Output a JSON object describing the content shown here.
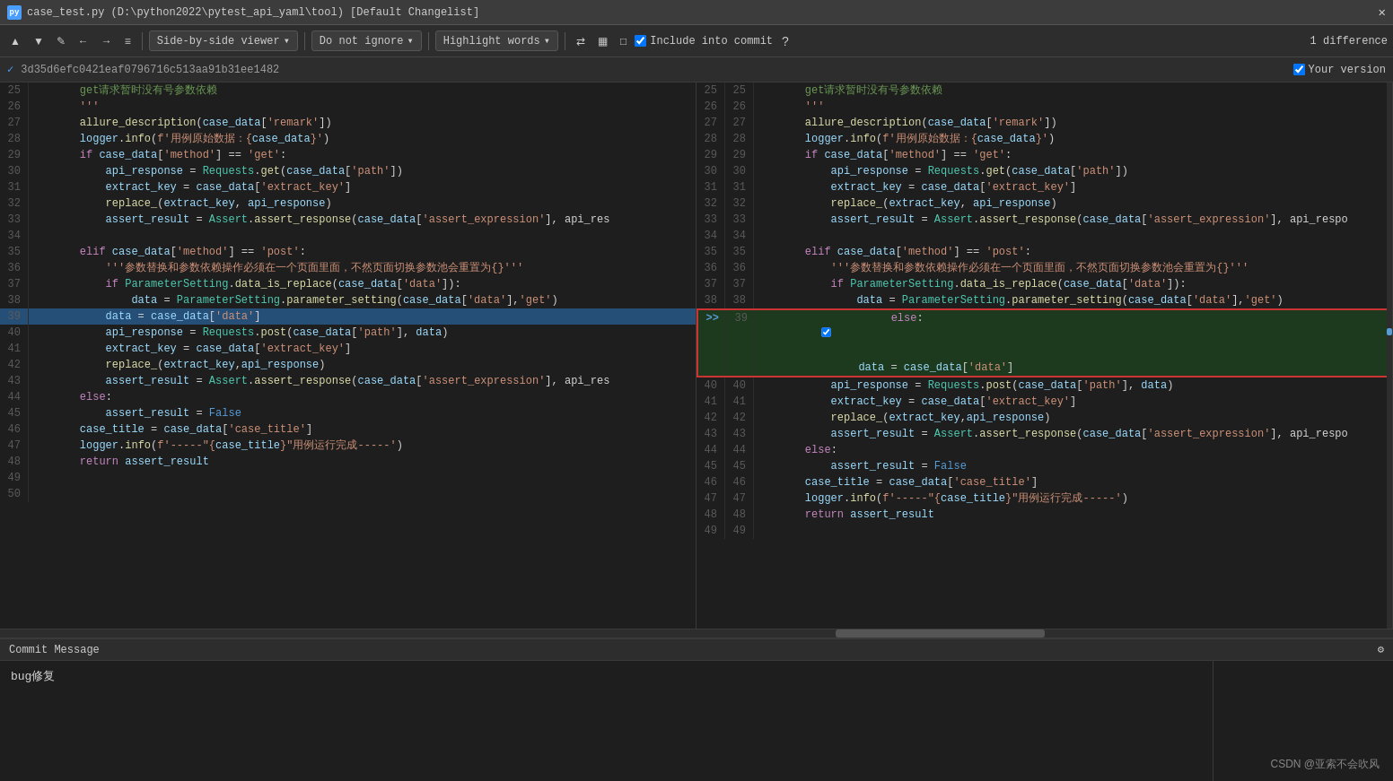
{
  "titleBar": {
    "icon": "py",
    "title": "case_test.py (D:\\python2022\\pytest_api_yaml\\tool) [Default Changelist]",
    "closeLabel": "✕"
  },
  "toolbar": {
    "prevBtn": "↑",
    "nextBtn": "↓",
    "editBtn": "✎",
    "backBtn": "←",
    "forwardBtn": "→",
    "menuBtn": "≡",
    "viewerLabel": "Side-by-side viewer",
    "viewerDropdown": "▾",
    "ignoreLabel": "Do not ignore",
    "ignoreDropdown": "▾",
    "highlightLabel": "Highlight words",
    "highlightDropdown": "▾",
    "icon1": "⇄",
    "icon2": "▦",
    "icon3": "□",
    "checkboxLabel": "Include into commit",
    "questionBtn": "?",
    "diffCount": "1 difference"
  },
  "hashBar": {
    "checkIcon": "✓",
    "hash": "3d35d6efc0421eaf0796716c513aa91b31ee1482",
    "yourVersionLabel": "Your version",
    "yourVersionChecked": true
  },
  "leftPanel": {
    "lines": [
      {
        "num": "25",
        "gutter": "",
        "content": "    get请求暂时没有号参数依赖",
        "type": "comment-cn"
      },
      {
        "num": "26",
        "gutter": "",
        "content": "    '''",
        "type": "str"
      },
      {
        "num": "27",
        "gutter": "",
        "content": "    allure_description(case_data['remark'])",
        "type": "normal"
      },
      {
        "num": "28",
        "gutter": "",
        "content": "    logger.info(f'用例原始数据：{case_data}')",
        "type": "normal"
      },
      {
        "num": "29",
        "gutter": "",
        "content": "    if case_data['method'] == 'get':",
        "type": "normal"
      },
      {
        "num": "30",
        "gutter": "",
        "content": "        api_response = Requests.get(case_data['path'])",
        "type": "normal"
      },
      {
        "num": "31",
        "gutter": "",
        "content": "        extract_key = case_data['extract_key']",
        "type": "normal"
      },
      {
        "num": "32",
        "gutter": "",
        "content": "        replace_(extract_key, api_response)",
        "type": "normal"
      },
      {
        "num": "33",
        "gutter": "",
        "content": "        assert_result = Assert.assert_response(case_data['assert_expression'], api_res",
        "type": "normal"
      },
      {
        "num": "34",
        "gutter": "",
        "content": "",
        "type": "empty"
      },
      {
        "num": "35",
        "gutter": "",
        "content": "    elif case_data['method'] == 'post':",
        "type": "normal"
      },
      {
        "num": "36",
        "gutter": "",
        "content": "        '''参数替换和参数依赖操作必须在一个页面里面，不然页面切换参数池会重置为{}'''",
        "type": "str-cn"
      },
      {
        "num": "37",
        "gutter": "",
        "content": "        if ParameterSetting.data_is_replace(case_data['data']):",
        "type": "normal"
      },
      {
        "num": "38",
        "gutter": "",
        "content": "            data = ParameterSetting.parameter_setting(case_data['data'],'get')",
        "type": "normal"
      },
      {
        "num": "39",
        "gutter": "  ",
        "content": "        data = case_data['data']",
        "type": "changed"
      },
      {
        "num": "40",
        "gutter": "",
        "content": "        api_response = Requests.post(case_data['path'], data)",
        "type": "normal"
      },
      {
        "num": "41",
        "gutter": "",
        "content": "        extract_key = case_data['extract_key']",
        "type": "normal"
      },
      {
        "num": "42",
        "gutter": "",
        "content": "        replace_(extract_key,api_response)",
        "type": "normal"
      },
      {
        "num": "43",
        "gutter": "",
        "content": "        assert_result = Assert.assert_response(case_data['assert_expression'], api_res",
        "type": "normal"
      },
      {
        "num": "44",
        "gutter": "",
        "content": "    else:",
        "type": "normal"
      },
      {
        "num": "45",
        "gutter": "",
        "content": "        assert_result = False",
        "type": "normal"
      },
      {
        "num": "46",
        "gutter": "",
        "content": "    case_title = case_data['case_title']",
        "type": "normal"
      },
      {
        "num": "47",
        "gutter": "",
        "content": "    logger.info(f'-----\"{case_title}\"用例运行完成-----')",
        "type": "normal"
      },
      {
        "num": "48",
        "gutter": "",
        "content": "    return assert_result",
        "type": "normal"
      },
      {
        "num": "49",
        "gutter": "",
        "content": "",
        "type": "empty"
      },
      {
        "num": "50",
        "gutter": "",
        "content": "",
        "type": "empty"
      }
    ]
  },
  "rightPanel": {
    "lines": [
      {
        "num1": "25",
        "num2": "25",
        "gutter": "",
        "content": "    get请求暂时没有号参数依赖",
        "type": "comment-cn"
      },
      {
        "num1": "26",
        "num2": "26",
        "gutter": "",
        "content": "    '''",
        "type": "str"
      },
      {
        "num1": "27",
        "num2": "27",
        "gutter": "",
        "content": "    allure_description(case_data['remark'])",
        "type": "normal"
      },
      {
        "num1": "28",
        "num2": "28",
        "gutter": "",
        "content": "    logger.info(f'用例原始数据：{case_data}')",
        "type": "normal"
      },
      {
        "num1": "29",
        "num2": "29",
        "gutter": "",
        "content": "    if case_data['method'] == 'get':",
        "type": "normal"
      },
      {
        "num1": "30",
        "num2": "30",
        "gutter": "",
        "content": "        api_response = Requests.get(case_data['path'])",
        "type": "normal"
      },
      {
        "num1": "31",
        "num2": "31",
        "gutter": "",
        "content": "        extract_key = case_data['extract_key']",
        "type": "normal"
      },
      {
        "num1": "32",
        "num2": "32",
        "gutter": "",
        "content": "        replace_(extract_key, api_response)",
        "type": "normal"
      },
      {
        "num1": "33",
        "num2": "33",
        "gutter": "",
        "content": "        assert_result = Assert.assert_response(case_data['assert_expression'], api_respo",
        "type": "normal"
      },
      {
        "num1": "34",
        "num2": "34",
        "gutter": "",
        "content": "",
        "type": "empty"
      },
      {
        "num1": "35",
        "num2": "35",
        "gutter": "",
        "content": "    elif case_data['method'] == 'post':",
        "type": "normal"
      },
      {
        "num1": "36",
        "num2": "36",
        "gutter": "",
        "content": "        '''参数替换和参数依赖操作必须在一个页面里面，不然页面切换参数池会重置为{}'''",
        "type": "str-cn"
      },
      {
        "num1": "37",
        "num2": "37",
        "gutter": "",
        "content": "        if ParameterSetting.data_is_replace(case_data['data']):",
        "type": "normal"
      },
      {
        "num1": "38",
        "num2": "38",
        "gutter": "",
        "content": "            data = ParameterSetting.parameter_setting(case_data['data'],'get')",
        "type": "normal"
      },
      {
        "num1": "39",
        "num2": "39",
        "gutter": ">>",
        "content": "        else:",
        "type": "added-border"
      },
      {
        "num1": "",
        "num2": "",
        "gutter": "",
        "content": "            data = case_data['data']",
        "type": "added-border-sub"
      },
      {
        "num1": "40",
        "num2": "40",
        "gutter": "",
        "content": "        api_response = Requests.post(case_data['path'], data)",
        "type": "normal"
      },
      {
        "num1": "41",
        "num2": "41",
        "gutter": "",
        "content": "        extract_key = case_data['extract_key']",
        "type": "normal"
      },
      {
        "num1": "42",
        "num2": "42",
        "gutter": "",
        "content": "        replace_(extract_key,api_response)",
        "type": "normal"
      },
      {
        "num1": "43",
        "num2": "43",
        "gutter": "",
        "content": "        assert_result = Assert.assert_response(case_data['assert_expression'], api_respo",
        "type": "normal"
      },
      {
        "num1": "44",
        "num2": "44",
        "gutter": "",
        "content": "    else:",
        "type": "normal"
      },
      {
        "num1": "45",
        "num2": "45",
        "gutter": "",
        "content": "        assert_result = False",
        "type": "normal"
      },
      {
        "num1": "46",
        "num2": "46",
        "gutter": "",
        "content": "    case_title = case_data['case_title']",
        "type": "normal"
      },
      {
        "num1": "47",
        "num2": "47",
        "gutter": "",
        "content": "    logger.info(f'-----\"{case_title}\"用例运行完成-----')",
        "type": "normal"
      },
      {
        "num1": "48",
        "num2": "48",
        "gutter": "",
        "content": "    return assert_result",
        "type": "normal"
      },
      {
        "num1": "49",
        "num2": "49",
        "gutter": "",
        "content": "",
        "type": "empty"
      }
    ]
  },
  "commitArea": {
    "header": "Commit Message",
    "settingsIcon": "⚙",
    "message": "bug修复"
  },
  "watermark": "CSDN @亚索不会吹风"
}
